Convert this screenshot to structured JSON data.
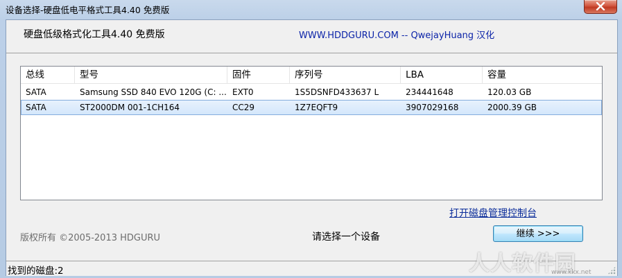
{
  "window": {
    "title": "设备选择-硬盘低电平格式工具4.40    免费版"
  },
  "header": {
    "app_title": "硬盘低级格式化工具4.40   免费版",
    "site_credit": "WWW.HDDGURU.COM -- QwejayHuang 汉化"
  },
  "table": {
    "columns": [
      "总线",
      "型号",
      "固件",
      "序列号",
      "LBA",
      "容量"
    ],
    "rows": [
      {
        "bus": "SATA",
        "model": "Samsung SSD 840 EVO 120G (C: ...",
        "firmware": "EXT0",
        "serial": "1S5DSNFD433637 L",
        "lba": "234441648",
        "capacity": "120.03 GB",
        "selected": false
      },
      {
        "bus": "SATA",
        "model": "ST2000DM 001-1CH164",
        "firmware": "CC29",
        "serial": "1Z7EQFT9",
        "lba": "3907029168",
        "capacity": "2000.39 GB",
        "selected": true
      }
    ]
  },
  "links": {
    "disk_management": "打开磁盘管理控制台"
  },
  "footer": {
    "copyright": "版权所有 ©2005-2013 HDGURU",
    "status_message": "请选择一个设备",
    "continue_label": "继续 >>>"
  },
  "statusbar": {
    "text": "找到的磁盘:2"
  },
  "watermark": {
    "text": "人人软件园",
    "sub": "www.kkx.net"
  },
  "colors": {
    "link": "#0b2d9a",
    "credit": "#0b23a8",
    "selection": "#d3e6fb",
    "close_button": "#c03a22"
  },
  "icons": {
    "close": "close-icon"
  }
}
